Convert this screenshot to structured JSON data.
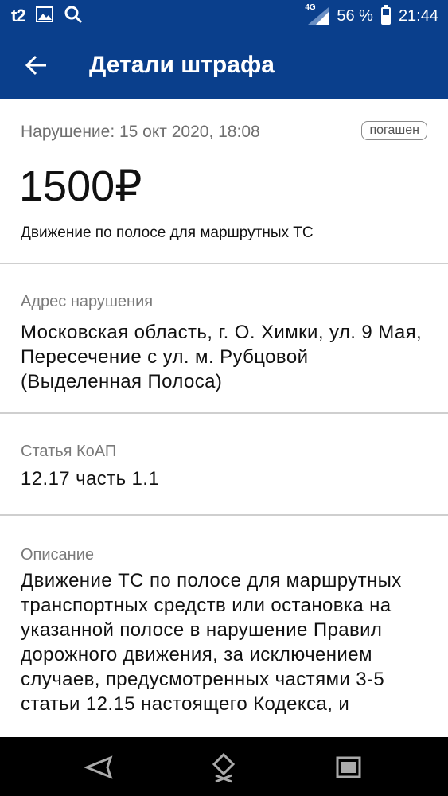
{
  "status_bar": {
    "carrier": "t2",
    "network": "4G",
    "battery": "56 %",
    "battery_level": 0.56,
    "time": "21:44",
    "icons": [
      "gallery-icon",
      "search-icon",
      "signal-icon",
      "battery-icon"
    ]
  },
  "app_bar": {
    "title": "Детали штрафа",
    "back_icon": "arrow-left-icon"
  },
  "fine": {
    "date": "Нарушение: 15 окт 2020, 18:08",
    "status": "погашен",
    "amount": "1500₽",
    "violation": "Движение по полосе для маршрутных ТС"
  },
  "address": {
    "label": "Адрес нарушения",
    "value": "Московская область, г. О. Химки, ул. 9 Мая, Пересечение с ул. м. Рубцовой (Выделенная Полоса)"
  },
  "article": {
    "label": "Статья КоАП",
    "value": "12.17 часть 1.1"
  },
  "description": {
    "label": "Описание",
    "value": "Движение ТС по полосе для маршрутных транспортных средств или остановка на указанной полосе в нарушение Правил дорожного движения, за исключением случаев, предусмотренных частями 3-5 статьи 12.15 настоящего Кодекса, и"
  },
  "nav_bar": {
    "icons": [
      "back-triangle-icon",
      "home-icon",
      "recents-icon"
    ]
  }
}
